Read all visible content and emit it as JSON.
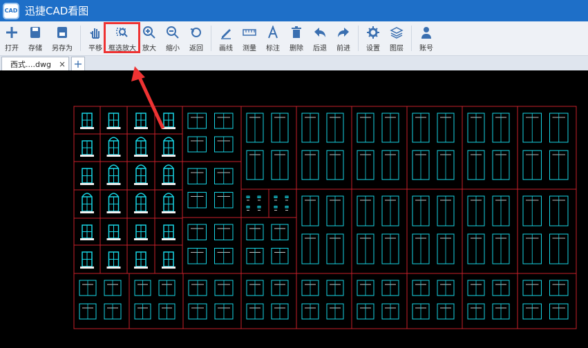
{
  "app": {
    "logo_text": "CAD",
    "title": "迅捷CAD看图"
  },
  "toolbar": {
    "items": [
      {
        "label": "打开",
        "icon": "plus-icon"
      },
      {
        "label": "存储",
        "icon": "save-icon"
      },
      {
        "label": "另存为",
        "icon": "save-as-icon"
      },
      {
        "label": "平移",
        "icon": "hand-icon"
      },
      {
        "label": "框选放大",
        "icon": "box-zoom-icon"
      },
      {
        "label": "放大",
        "icon": "zoom-in-icon"
      },
      {
        "label": "缩小",
        "icon": "zoom-out-icon"
      },
      {
        "label": "返回",
        "icon": "back-icon"
      },
      {
        "label": "画线",
        "icon": "pen-icon"
      },
      {
        "label": "测量",
        "icon": "ruler-icon"
      },
      {
        "label": "标注",
        "icon": "text-icon"
      },
      {
        "label": "删除",
        "icon": "trash-icon"
      },
      {
        "label": "后退",
        "icon": "undo-icon"
      },
      {
        "label": "前进",
        "icon": "redo-icon"
      },
      {
        "label": "设置",
        "icon": "gear-icon"
      },
      {
        "label": "图层",
        "icon": "layers-icon"
      },
      {
        "label": "账号",
        "icon": "user-icon"
      }
    ]
  },
  "tabs": {
    "file_tab": "西式....dwg",
    "close": "×",
    "add": "+"
  },
  "colors": {
    "titlebar": "#1e6fc8",
    "toolbar_icon": "#3a6fb0",
    "frame": "#c8202a",
    "drawing": "#18d8e8",
    "highlight": "#e33333"
  }
}
